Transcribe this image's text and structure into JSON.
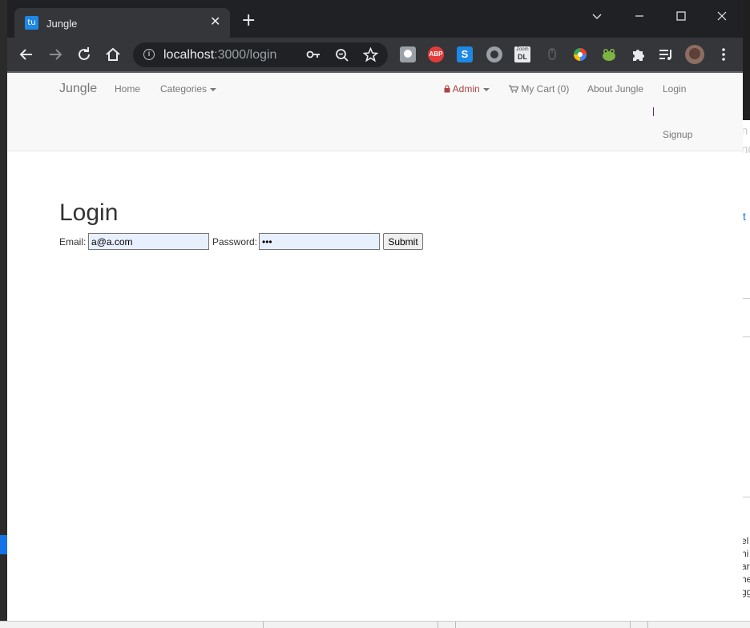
{
  "browser": {
    "tab": {
      "favicon_text": "tu",
      "title": "Jungle",
      "close_glyph": "✕"
    },
    "new_tab_glyph": "+",
    "url_host": "localhost",
    "url_path": ":3000/login",
    "extension_labels": {
      "abp": "ABP",
      "s": "S",
      "zoom_top": "Zoom",
      "zoom_bottom": "DL"
    }
  },
  "navbar": {
    "brand": "Jungle",
    "home": "Home",
    "categories": "Categories",
    "admin": "Admin",
    "cart": "My Cart (0)",
    "about": "About Jungle",
    "login": "Login",
    "signup": "Signup"
  },
  "login": {
    "title": "Login",
    "email_label": "Email:",
    "email_value": "a@a.com",
    "password_label": "Password:",
    "password_value": "abc",
    "submit_label": "Submit"
  },
  "background": {
    "right_fragments": [
      "n",
      "nd",
      "el",
      "ni",
      "ar",
      "ne",
      "gg"
    ],
    "right_link": "t"
  },
  "colors": {
    "admin": "#a94442",
    "navbar_bg": "#f8f8f8",
    "autofill_bg": "#e8f0fe",
    "chrome_dark": "#202124",
    "chrome_toolbar": "#35363a"
  },
  "icons": [
    "back-icon",
    "forward-icon",
    "reload-icon",
    "home-icon",
    "info-icon",
    "key-icon",
    "zoom-out-icon",
    "star-icon",
    "lock-icon",
    "cart-icon",
    "puzzle-icon",
    "playlist-icon",
    "minimize-icon",
    "maximize-icon",
    "close-icon",
    "chevron-down-icon"
  ]
}
